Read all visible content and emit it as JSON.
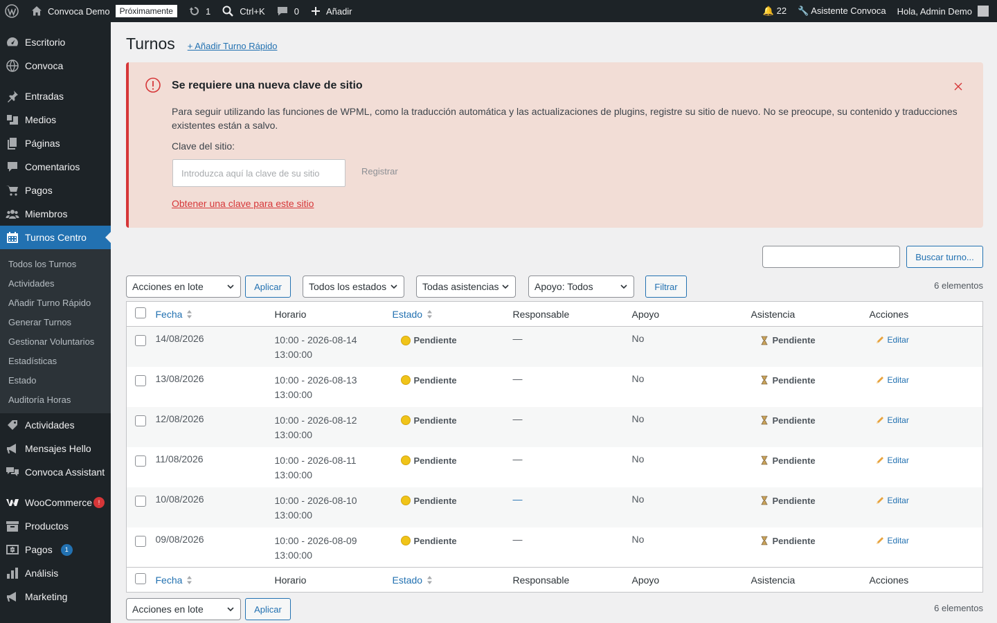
{
  "adminbar": {
    "site_name": "Convoca Demo",
    "coming_soon": "Próximamente",
    "updates_count": "1",
    "search_shortcut": "Ctrl+K",
    "comments_count": "0",
    "add_new": "Añadir",
    "notifications": "🔔 22",
    "assistant": "🔧 Asistente Convoca",
    "greeting": "Hola, Admin Demo"
  },
  "sidebar": {
    "items": [
      {
        "label": "Escritorio",
        "icon": "dashboard-icon"
      },
      {
        "label": "Convoca",
        "icon": "globe-icon"
      },
      {
        "label": "Entradas",
        "icon": "pin-icon"
      },
      {
        "label": "Medios",
        "icon": "media-icon"
      },
      {
        "label": "Páginas",
        "icon": "pages-icon"
      },
      {
        "label": "Comentarios",
        "icon": "comment-icon"
      },
      {
        "label": "Pagos",
        "icon": "cart-icon"
      },
      {
        "label": "Miembros",
        "icon": "groups-icon"
      },
      {
        "label": "Turnos Centro",
        "icon": "calendar-icon"
      }
    ],
    "submenu": [
      "Todos los Turnos",
      "Actividades",
      "Añadir Turno Rápido",
      "Generar Turnos",
      "Gestionar Voluntarios",
      "Estadísticas",
      "Estado",
      "Auditoría Horas"
    ],
    "items_after": [
      {
        "label": "Actividades",
        "icon": "tag-icon"
      },
      {
        "label": "Mensajes Hello",
        "icon": "megaphone-icon"
      },
      {
        "label": "Convoca Assistant",
        "icon": "chat-icon"
      },
      {
        "label": "WooCommerce",
        "icon": "woo-icon",
        "badge": "!"
      },
      {
        "label": "Productos",
        "icon": "archive-icon"
      },
      {
        "label": "Pagos",
        "icon": "payment-icon",
        "badge": "1"
      },
      {
        "label": "Análisis",
        "icon": "bar-chart-icon"
      },
      {
        "label": "Marketing",
        "icon": "megaphone-icon"
      }
    ]
  },
  "page": {
    "title": "Turnos",
    "add_quick": "+ Añadir Turno Rápido"
  },
  "notice": {
    "title": "Se requiere una nueva clave de sitio",
    "text": "Para seguir utilizando las funciones de WPML, como la traducción automática y las actualizaciones de plugins, registre su sitio de nuevo. No se preocupe, su contenido y traducciones existentes están a salvo.",
    "site_key_label": "Clave del sitio:",
    "site_key_placeholder": "Introduzca aquí la clave de su sitio",
    "register": "Registrar",
    "get_key_link": "Obtener una clave para este sitio"
  },
  "search": {
    "button": "Buscar turno..."
  },
  "filters": {
    "bulk_actions": "Acciones en lote",
    "apply": "Aplicar",
    "status": "Todos los estados",
    "attendance": "Todas asistencias",
    "support": "Apoyo: Todos",
    "filter": "Filtrar",
    "items_count": "6 elementos"
  },
  "table": {
    "columns": {
      "date": "Fecha",
      "schedule": "Horario",
      "status": "Estado",
      "responsible": "Responsable",
      "support": "Apoyo",
      "attendance": "Asistencia",
      "actions": "Acciones"
    },
    "rows": [
      {
        "date": "14/08/2026",
        "schedule_line1": "10:00 - 2026-08-14",
        "schedule_line2": "13:00:00",
        "status": "Pendiente",
        "responsible": "—",
        "support": "No",
        "attendance": "Pendiente",
        "action": "Editar"
      },
      {
        "date": "13/08/2026",
        "schedule_line1": "10:00 - 2026-08-13",
        "schedule_line2": "13:00:00",
        "status": "Pendiente",
        "responsible": "—",
        "support": "No",
        "attendance": "Pendiente",
        "action": "Editar"
      },
      {
        "date": "12/08/2026",
        "schedule_line1": "10:00 - 2026-08-12",
        "schedule_line2": "13:00:00",
        "status": "Pendiente",
        "responsible": "—",
        "support": "No",
        "attendance": "Pendiente",
        "action": "Editar"
      },
      {
        "date": "11/08/2026",
        "schedule_line1": "10:00 - 2026-08-11",
        "schedule_line2": "13:00:00",
        "status": "Pendiente",
        "responsible": "—",
        "support": "No",
        "attendance": "Pendiente",
        "action": "Editar"
      },
      {
        "date": "10/08/2026",
        "schedule_line1": "10:00 - 2026-08-10",
        "schedule_line2": "13:00:00",
        "status": "Pendiente",
        "responsible": "—",
        "support": "No",
        "attendance": "Pendiente",
        "action": "Editar"
      },
      {
        "date": "09/08/2026",
        "schedule_line1": "10:00 - 2026-08-09",
        "schedule_line2": "13:00:00",
        "status": "Pendiente",
        "responsible": "—",
        "support": "No",
        "attendance": "Pendiente",
        "action": "Editar"
      }
    ]
  },
  "colors": {
    "adminbar_bg": "#1d2327",
    "accent": "#2271b1",
    "notice_bg": "#f2ddd6",
    "notice_border": "#d63638",
    "woo_badge": "#d63638",
    "payment_badge": "#2271b1"
  }
}
